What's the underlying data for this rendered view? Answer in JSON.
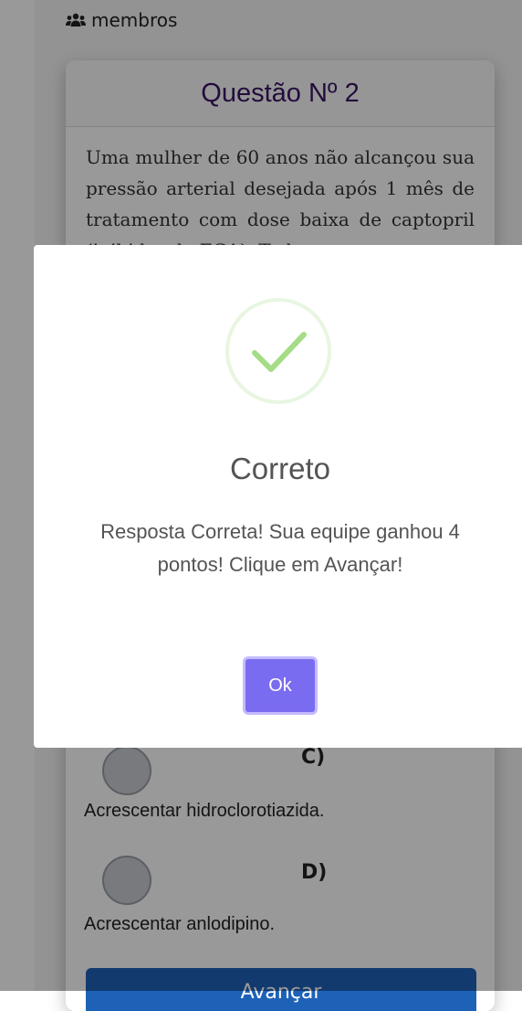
{
  "header": {
    "members_icon": "users-icon",
    "members_label": "membros"
  },
  "question": {
    "title": "Questão Nº 2",
    "text": "Uma mulher de 60 anos não alcançou sua pressão arterial desejada após 1 mês de tratamento com dose baixa de captopril (inibidor da ECA). Todos os"
  },
  "options": [
    {
      "letter": "C)",
      "text": "Acrescentar hidroclorotiazida."
    },
    {
      "letter": "D)",
      "text": "Acrescentar anlodipino."
    }
  ],
  "advance_button_label": "Avançar",
  "modal": {
    "icon": "check-circle-icon",
    "title": "Correto",
    "message": "Resposta Correta! Sua equipe ganhou 4 pontos! Clique em Avançar!",
    "ok_label": "Ok",
    "colors": {
      "ok_button": "#7a6cf0",
      "check": "#a5dc86"
    }
  }
}
